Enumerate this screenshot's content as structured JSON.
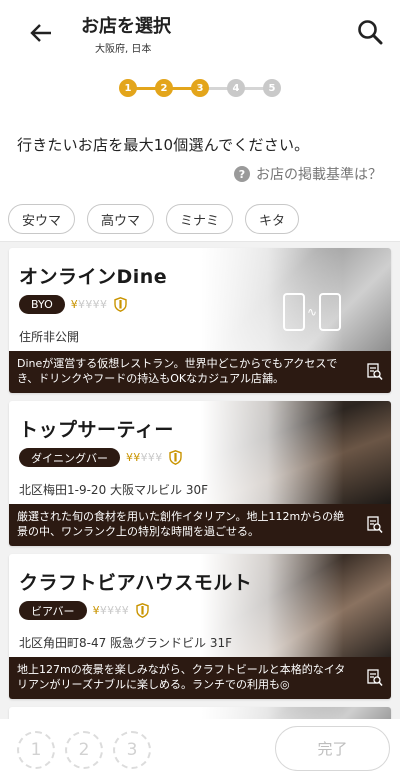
{
  "header": {
    "title": "お店を選択",
    "subtitle": "大阪府, 日本"
  },
  "steps": [
    "1",
    "2",
    "3",
    "4",
    "5"
  ],
  "instruction": "行きたいお店を最大10個選んでください。",
  "criteria_link": "お店の掲載基準は？",
  "chips": [
    "安ウマ",
    "高ウマ",
    "ミナミ",
    "キタ"
  ],
  "cards": [
    {
      "name": "オンラインDine",
      "badge": "BYO",
      "price_on": "¥",
      "price_off": "¥¥¥¥",
      "address": "住所非公開",
      "description": "Dineが運営する仮想レストラン。世界中どこからでもアクセスでき、ドリンクやフードの持込もOKなカジュアル店舗。"
    },
    {
      "name": "トップサーティー",
      "badge": "ダイニングバー",
      "price_on": "¥¥",
      "price_off": "¥¥¥",
      "address": "北区梅田1-9-20 大阪マルビル 30F",
      "description": "厳選された旬の食材を用いた創作イタリアン。地上112mからの絶景の中、ワンランク上の特別な時間を過ごせる。"
    },
    {
      "name": "クラフトビアハウスモルト",
      "badge": "ビアバー",
      "price_on": "¥",
      "price_off": "¥¥¥¥",
      "address": "北区角田町8-47 阪急グランドビル 31F",
      "description": "地上127mの夜景を楽しみながら、クラフトビールと本格的なイタリアンがリーズナブルに楽しめる。ランチでの利用も◎"
    }
  ],
  "bottom": {
    "slots": [
      "1",
      "2",
      "3"
    ],
    "done_label": "完了"
  },
  "colors": {
    "accent": "#e3a51b",
    "dark_brown": "#2c1a12"
  }
}
